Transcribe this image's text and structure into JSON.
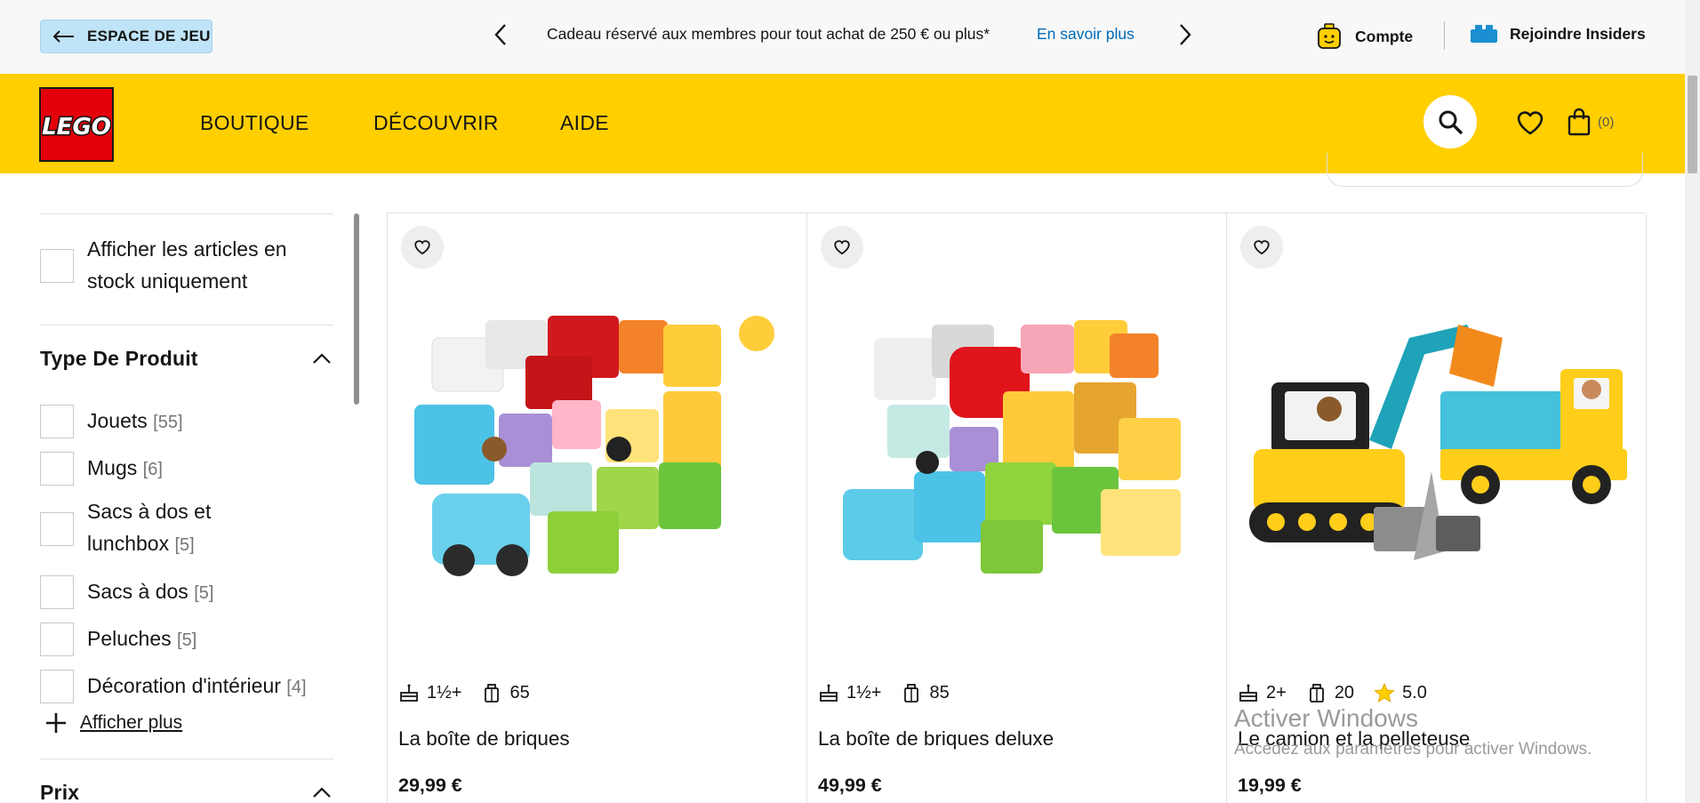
{
  "topbar": {
    "back_label": "ESPACE DE JEU",
    "promo_text": "Cadeau réservé aux membres pour tout achat de 250 € ou plus*",
    "promo_link": "En savoir plus",
    "account_label": "Compte",
    "insiders_label": "Rejoindre Insiders"
  },
  "nav": {
    "logo_text": "LEGO",
    "items": [
      "BOUTIQUE",
      "DÉCOUVRIR",
      "AIDE"
    ],
    "cart_count": "(0)"
  },
  "filters": {
    "in_stock_label_1": "Afficher les articles en",
    "in_stock_label_2": "stock uniquement",
    "type_title": "Type De Produit",
    "types": [
      {
        "label": "Jouets",
        "count": "[55]"
      },
      {
        "label": "Mugs",
        "count": "[6]"
      },
      {
        "label": "Sacs à dos et",
        "label2": "lunchbox",
        "count": "[5]"
      },
      {
        "label": "Sacs à dos",
        "count": "[5]"
      },
      {
        "label": "Peluches",
        "count": "[5]"
      },
      {
        "label": "Décoration d'intérieur",
        "count": "[4]"
      }
    ],
    "show_more": "Afficher plus",
    "price_title": "Prix"
  },
  "products": [
    {
      "age": "1½+",
      "pieces": "65",
      "name": "La boîte de briques",
      "price": "29,99 €"
    },
    {
      "age": "1½+",
      "pieces": "85",
      "name": "La boîte de briques deluxe",
      "price": "49,99 €"
    },
    {
      "age": "2+",
      "pieces": "20",
      "rating": "5.0",
      "name": "Le camion et la pelleteuse",
      "price": "19,99 €"
    }
  ],
  "watermark": {
    "line1": "Activer Windows",
    "line2": "Accédez aux paramètres pour activer Windows."
  },
  "colors": {
    "nav_yellow": "#ffcf00",
    "lego_red": "#e3000b",
    "link_blue": "#006cb7",
    "back_button_bg": "#bfe3f7"
  }
}
